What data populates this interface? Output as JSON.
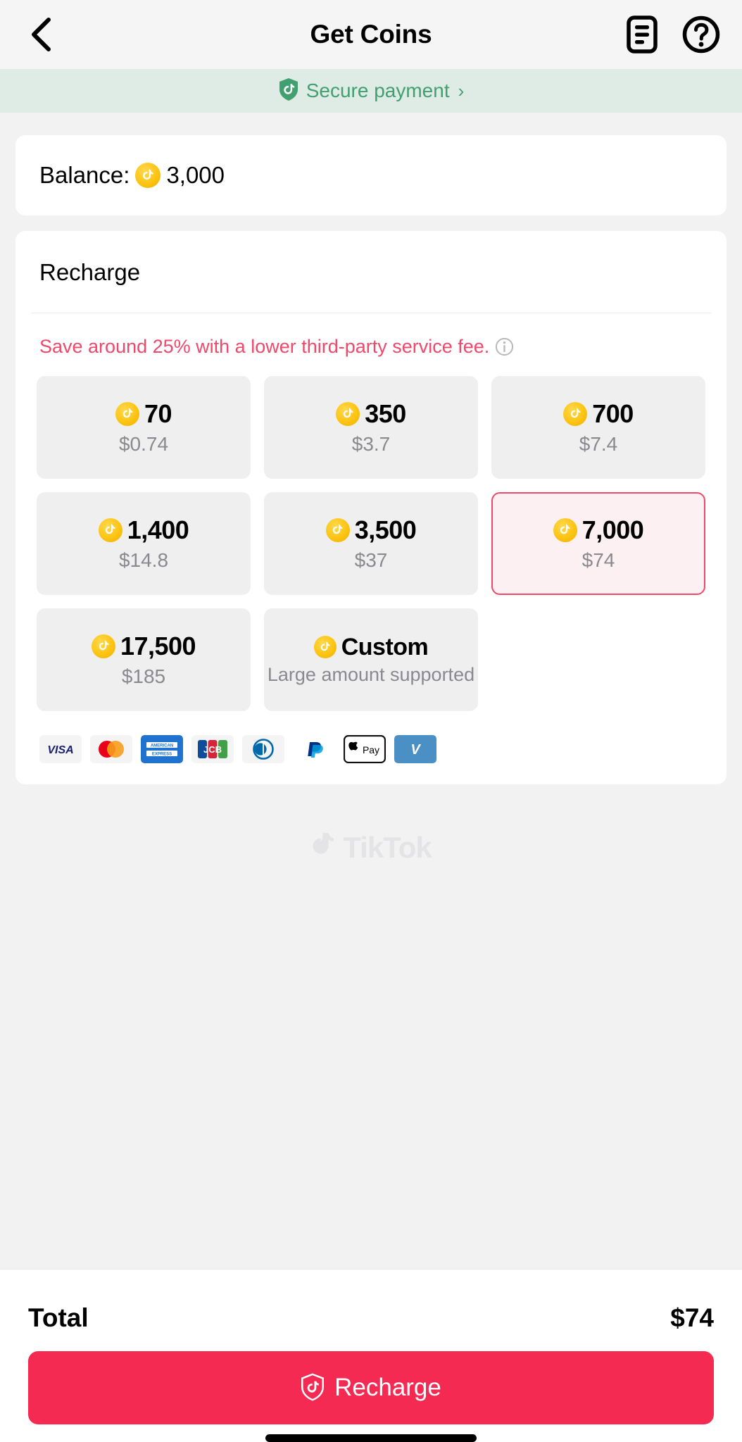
{
  "header": {
    "title": "Get Coins",
    "back_icon": "chevron-left-icon",
    "records_icon": "records-document-icon",
    "help_icon": "help-circle-icon"
  },
  "secure_banner": {
    "icon": "shield-tiktok-icon",
    "text": "Secure payment",
    "chevron": "›",
    "accent": "#41a06f",
    "background": "#dfebe5"
  },
  "balance": {
    "label": "Balance:",
    "amount": "3,000",
    "coin_icon": "tiktok-coin-icon"
  },
  "recharge": {
    "title": "Recharge",
    "promo_text": "Save around 25% with a lower third-party service fee.",
    "promo_color": "#f0486b",
    "info_icon": "info-circle-icon",
    "packages": [
      {
        "coins": "70",
        "price": "$0.74",
        "selected": false
      },
      {
        "coins": "350",
        "price": "$3.7",
        "selected": false
      },
      {
        "coins": "700",
        "price": "$7.4",
        "selected": false
      },
      {
        "coins": "1,400",
        "price": "$14.8",
        "selected": false
      },
      {
        "coins": "3,500",
        "price": "$37",
        "selected": false
      },
      {
        "coins": "7,000",
        "price": "$74",
        "selected": true
      },
      {
        "coins": "17,500",
        "price": "$185",
        "selected": false
      },
      {
        "coins": "Custom",
        "price": "Large amount supported",
        "selected": false,
        "custom": true
      }
    ],
    "selected_border": "#ef4868",
    "selected_background": "#fdf0f3"
  },
  "payment_methods": [
    {
      "name": "visa-logo",
      "label": "VISA"
    },
    {
      "name": "mastercard-logo",
      "label": "Mastercard"
    },
    {
      "name": "american-express-logo",
      "label": "AMERICAN EXPRESS"
    },
    {
      "name": "jcb-logo",
      "label": "JCB"
    },
    {
      "name": "diners-club-logo",
      "label": "Diners Club"
    },
    {
      "name": "paypal-logo",
      "label": "PayPal"
    },
    {
      "name": "apple-pay-logo",
      "label": "Apple Pay"
    },
    {
      "name": "venmo-logo",
      "label": "Venmo"
    }
  ],
  "watermark": {
    "text": "TikTok",
    "icon": "tiktok-note-icon"
  },
  "bottom": {
    "total_label": "Total",
    "total_value": "$74",
    "button_label": "Recharge",
    "button_icon": "shield-tiktok-icon",
    "button_color": "#f42a53"
  }
}
